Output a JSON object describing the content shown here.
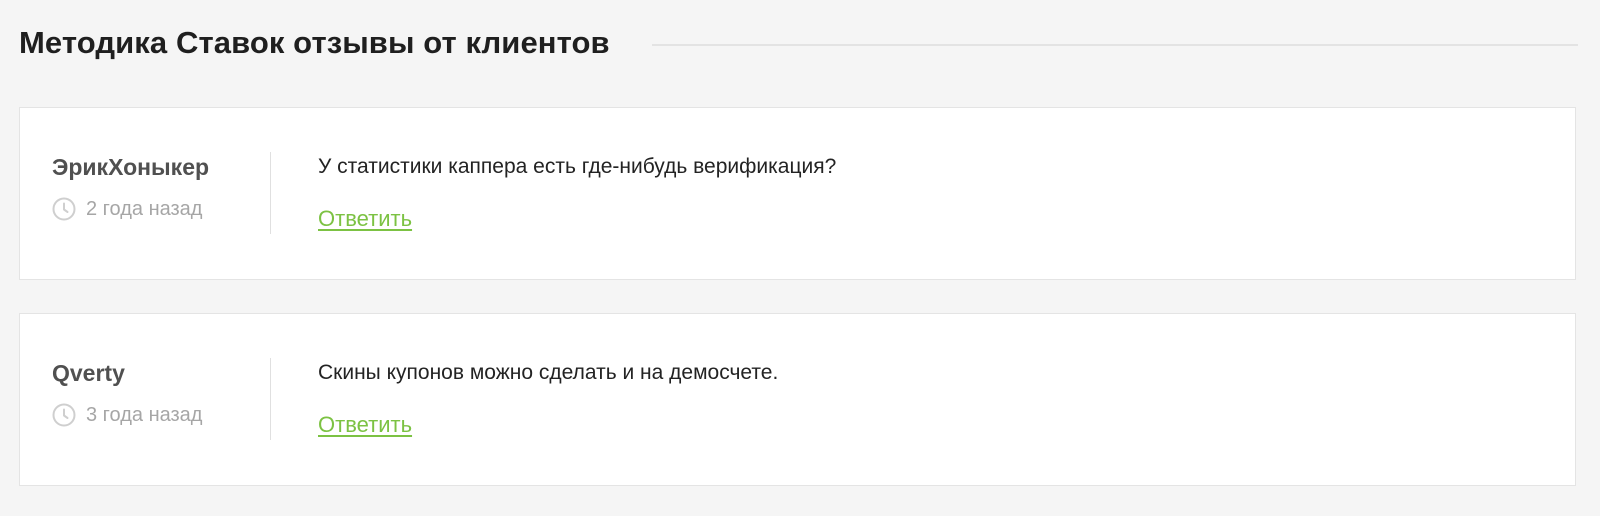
{
  "section": {
    "title": "Методика Ставок отзывы от клиентов"
  },
  "reviews": [
    {
      "author": "ЭрикХоныкер",
      "date": "2 года назад",
      "text": "У статистики каппера есть где-нибудь верификация?",
      "reply_label": "Ответить"
    },
    {
      "author": "Qverty",
      "date": "3 года назад",
      "text": "Скины купонов можно сделать и на демосчете.",
      "reply_label": "Ответить"
    }
  ],
  "icons": {
    "date_icon": "clock-icon"
  },
  "colors": {
    "accent": "#7cc243",
    "background": "#f5f5f5",
    "card": "#ffffff"
  }
}
